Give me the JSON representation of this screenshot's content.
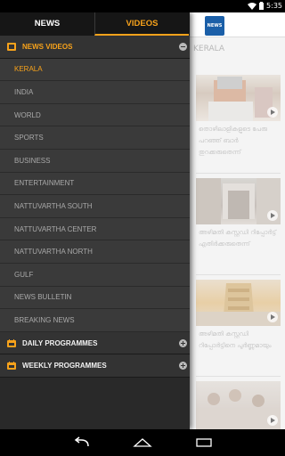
{
  "status_bar": {
    "time": "5:35"
  },
  "tabs": [
    {
      "label": "NEWS",
      "active": false
    },
    {
      "label": "VIDEOS",
      "active": true
    }
  ],
  "menu": {
    "news_videos": {
      "label": "NEWS VIDEOS",
      "expanded": true,
      "items": [
        {
          "label": "KERALA",
          "active": true
        },
        {
          "label": "INDIA",
          "active": false
        },
        {
          "label": "WORLD",
          "active": false
        },
        {
          "label": "SPORTS",
          "active": false
        },
        {
          "label": "BUSINESS",
          "active": false
        },
        {
          "label": "ENTERTAINMENT",
          "active": false
        },
        {
          "label": "NATTUVARTHA SOUTH",
          "active": false
        },
        {
          "label": "NATTUVARTHA CENTER",
          "active": false
        },
        {
          "label": "NATTUVARTHA NORTH",
          "active": false
        },
        {
          "label": "GULF",
          "active": false
        },
        {
          "label": "NEWS BULLETIN",
          "active": false
        },
        {
          "label": "BREAKING NEWS",
          "active": false
        }
      ]
    },
    "daily_programmes": {
      "label": "DAILY PROGRAMMES",
      "expanded": false
    },
    "weekly_programmes": {
      "label": "WEEKLY PROGRAMMES",
      "expanded": false
    }
  },
  "background": {
    "logo_text": "NEWS",
    "section_title": "KERALA",
    "cards": [
      {
        "caption": "തൊഴിലാളികളുടെ പേരു പറഞ്ഞ് ബാർ തുറക്കരുതെന്ന്"
      },
      {
        "caption": "അഴിമതി കസ്റ്റഡി റിപ്പോർട്ട് എതിർക്കരുതെന്ന്"
      },
      {
        "caption": "അഴിമതി കസ്റ്റഡി റിപ്പോർട്ടിനെ പുർണ്ണമായും"
      }
    ]
  },
  "colors": {
    "accent": "#f7a21b",
    "drawer_bg": "#292929",
    "submenu_bg": "#3a3a3a",
    "tab_bar_bg": "#161616"
  },
  "icons": {
    "news_videos": "film-icon",
    "daily_programmes": "calendar-icon",
    "weekly_programmes": "calendar-icon",
    "back": "back-icon",
    "home": "home-icon",
    "recents": "recents-icon"
  }
}
